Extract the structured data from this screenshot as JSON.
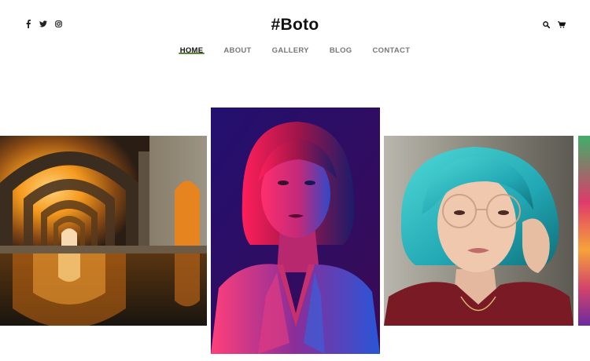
{
  "header": {
    "logo": "#Boto",
    "social_icons": [
      "facebook-icon",
      "twitter-icon",
      "instagram-icon"
    ],
    "tool_icons": [
      "search-icon",
      "cart-icon"
    ]
  },
  "nav": {
    "items": [
      {
        "label": "HOME",
        "active": true
      },
      {
        "label": "ABOUT",
        "active": false
      },
      {
        "label": "GALLERY",
        "active": false
      },
      {
        "label": "BLOG",
        "active": false
      },
      {
        "label": "CONTACT",
        "active": false
      }
    ],
    "active_color": "#4a7a16"
  },
  "gallery": {
    "slides": [
      {
        "subject": "orange-lit arched corridor reflected in water"
      },
      {
        "subject": "woman portrait lit in pink and blue neon"
      },
      {
        "subject": "woman with turquoise hair and round glasses"
      },
      {
        "subject": "colorful partially visible image"
      }
    ]
  }
}
